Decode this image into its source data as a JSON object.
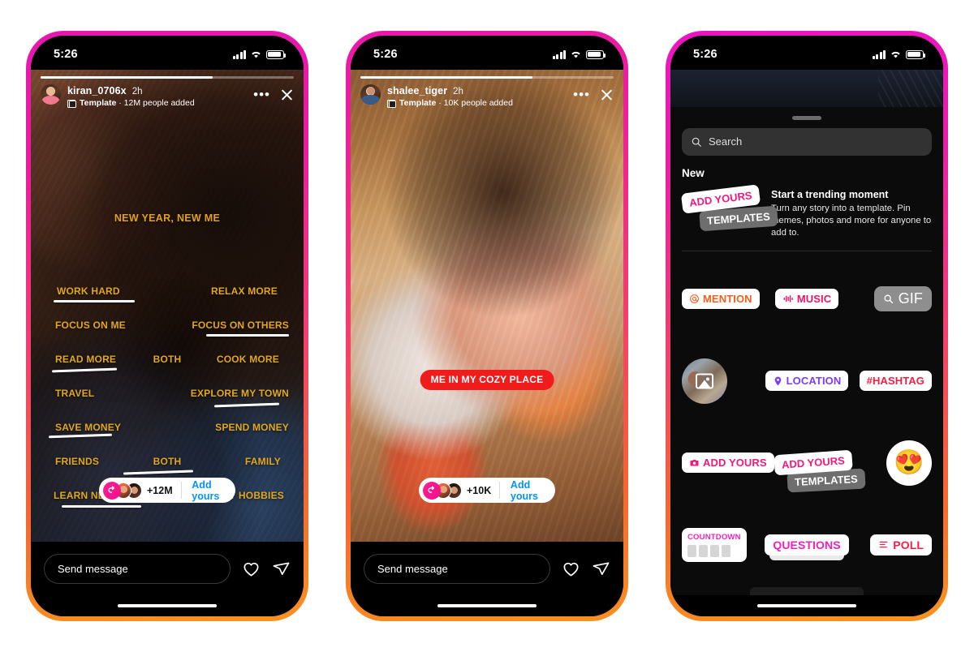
{
  "status_bar": {
    "time": "5:26",
    "signal_icon": "cellular-bars-icon",
    "wifi_icon": "wifi-icon",
    "battery_icon": "battery-full-icon"
  },
  "phone1": {
    "story": {
      "username": "kiran_0706x",
      "time_ago": "2h",
      "template_label": "Template",
      "meta_separator": " · ",
      "added_count": "12M people added",
      "more_icon": "ellipsis-icon",
      "close_icon": "close-icon",
      "title": "NEW YEAR, NEW ME",
      "rows": [
        {
          "left": "WORK HARD",
          "middle": "",
          "right": "RELAX MORE"
        },
        {
          "left": "FOCUS ON ME",
          "middle": "",
          "right": "FOCUS ON OTHERS"
        },
        {
          "left": "READ MORE",
          "middle": "BOTH",
          "right": "COOK MORE"
        },
        {
          "left": "TRAVEL",
          "middle": "",
          "right": "EXPLORE MY TOWN"
        },
        {
          "left": "SAVE MONEY",
          "middle": "",
          "right": "SPEND MONEY"
        },
        {
          "left": "FRIENDS",
          "middle": "BOTH",
          "right": "FAMILY"
        },
        {
          "left": "LEARN NEW THINGS",
          "middle": "",
          "right": "DO MY HOBBIES"
        }
      ],
      "add_yours": {
        "count": "+12M",
        "cta": "Add yours",
        "badge_icon": "add-yours-arrow-icon"
      }
    },
    "footer": {
      "message_placeholder": "Send message",
      "like_icon": "heart-icon",
      "share_icon": "paper-plane-icon"
    }
  },
  "phone2": {
    "story": {
      "username": "shalee_tiger",
      "time_ago": "2h",
      "template_label": "Template",
      "meta_separator": " · ",
      "added_count": "10K people added",
      "more_icon": "ellipsis-icon",
      "close_icon": "close-icon",
      "caption": "ME IN MY COZY PLACE",
      "add_yours": {
        "count": "+10K",
        "cta": "Add yours",
        "badge_icon": "add-yours-arrow-icon"
      }
    },
    "footer": {
      "message_placeholder": "Send message",
      "like_icon": "heart-icon",
      "share_icon": "paper-plane-icon"
    }
  },
  "phone3": {
    "search": {
      "placeholder": "Search",
      "icon": "search-icon"
    },
    "section_title": "New",
    "promo": {
      "sticker_top": "ADD YOURS",
      "sticker_bottom": "TEMPLATES",
      "heading": "Start a trending moment",
      "body": "Turn any story into a template. Pin memes, photos and more for anyone to add to."
    },
    "stickers": {
      "mention": "MENTION",
      "mention_icon": "at-sign-icon",
      "music": "MUSIC",
      "music_icon": "music-waveform-icon",
      "gif": "GIF",
      "gif_icon": "search-icon",
      "photo_sticker_icon": "photo-sticker-icon",
      "location": "LOCATION",
      "location_icon": "map-pin-icon",
      "hashtag": "#HASHTAG",
      "add_yours": "ADD YOURS",
      "add_yours_icon": "camera-icon",
      "add_yours_templates_top": "ADD YOURS",
      "add_yours_templates_bottom": "TEMPLATES",
      "emoji": "😍",
      "countdown": "COUNTDOWN",
      "questions": "QUESTIONS",
      "poll": "POLL",
      "poll_icon": "poll-bars-icon"
    }
  },
  "colors": {
    "instagram_blue": "#0095f6",
    "pink": "#f0197f",
    "magenta": "#f11fc0",
    "orange": "#f0601e",
    "purple": "#7b3df5",
    "red": "#f11f44",
    "template_yellow": "#e2a818",
    "caption_red": "#f01b1b"
  }
}
